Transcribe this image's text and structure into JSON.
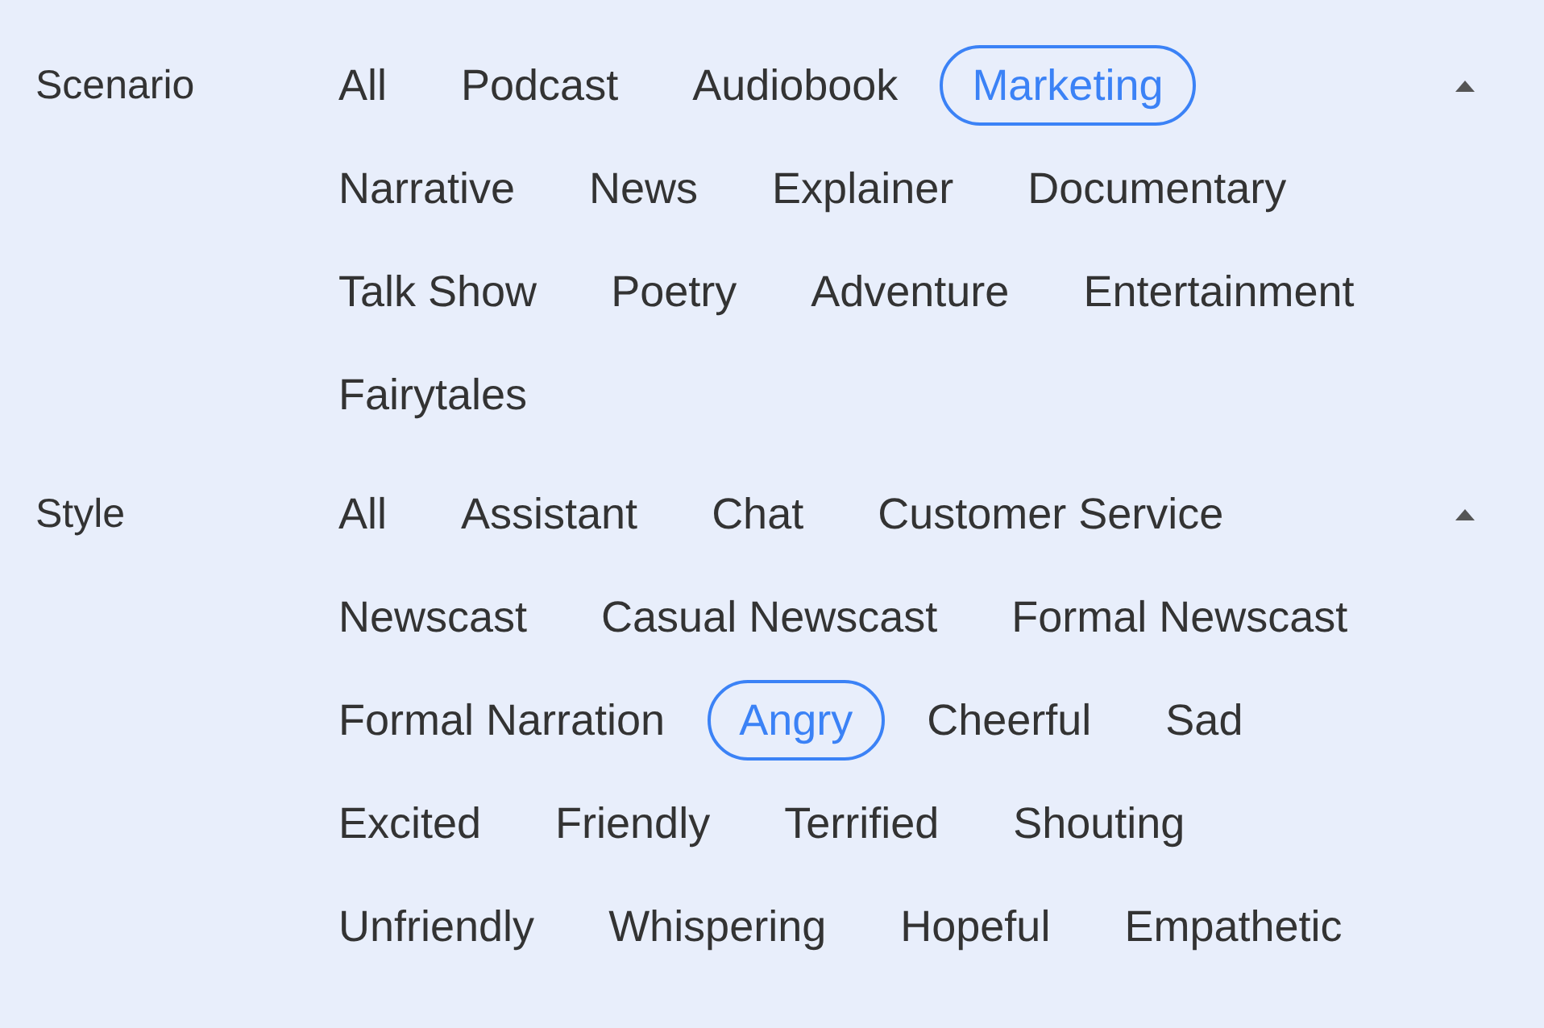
{
  "filters": [
    {
      "label": "Scenario",
      "expanded": true,
      "options": [
        {
          "label": "All",
          "selected": false
        },
        {
          "label": "Podcast",
          "selected": false
        },
        {
          "label": "Audiobook",
          "selected": false
        },
        {
          "label": "Marketing",
          "selected": true
        },
        {
          "label": "Narrative",
          "selected": false
        },
        {
          "label": "News",
          "selected": false
        },
        {
          "label": "Explainer",
          "selected": false
        },
        {
          "label": "Documentary",
          "selected": false
        },
        {
          "label": "Talk Show",
          "selected": false
        },
        {
          "label": "Poetry",
          "selected": false
        },
        {
          "label": "Adventure",
          "selected": false
        },
        {
          "label": "Entertainment",
          "selected": false
        },
        {
          "label": "Fairytales",
          "selected": false
        }
      ]
    },
    {
      "label": "Style",
      "expanded": true,
      "options": [
        {
          "label": "All",
          "selected": false
        },
        {
          "label": "Assistant",
          "selected": false
        },
        {
          "label": "Chat",
          "selected": false
        },
        {
          "label": "Customer Service",
          "selected": false
        },
        {
          "label": "Newscast",
          "selected": false
        },
        {
          "label": "Casual Newscast",
          "selected": false
        },
        {
          "label": "Formal Newscast",
          "selected": false
        },
        {
          "label": "Formal Narration",
          "selected": false
        },
        {
          "label": "Angry",
          "selected": true
        },
        {
          "label": "Cheerful",
          "selected": false
        },
        {
          "label": "Sad",
          "selected": false
        },
        {
          "label": "Excited",
          "selected": false
        },
        {
          "label": "Friendly",
          "selected": false
        },
        {
          "label": "Terrified",
          "selected": false
        },
        {
          "label": "Shouting",
          "selected": false
        },
        {
          "label": "Unfriendly",
          "selected": false
        },
        {
          "label": "Whispering",
          "selected": false
        },
        {
          "label": "Hopeful",
          "selected": false
        },
        {
          "label": "Empathetic",
          "selected": false
        }
      ]
    }
  ]
}
